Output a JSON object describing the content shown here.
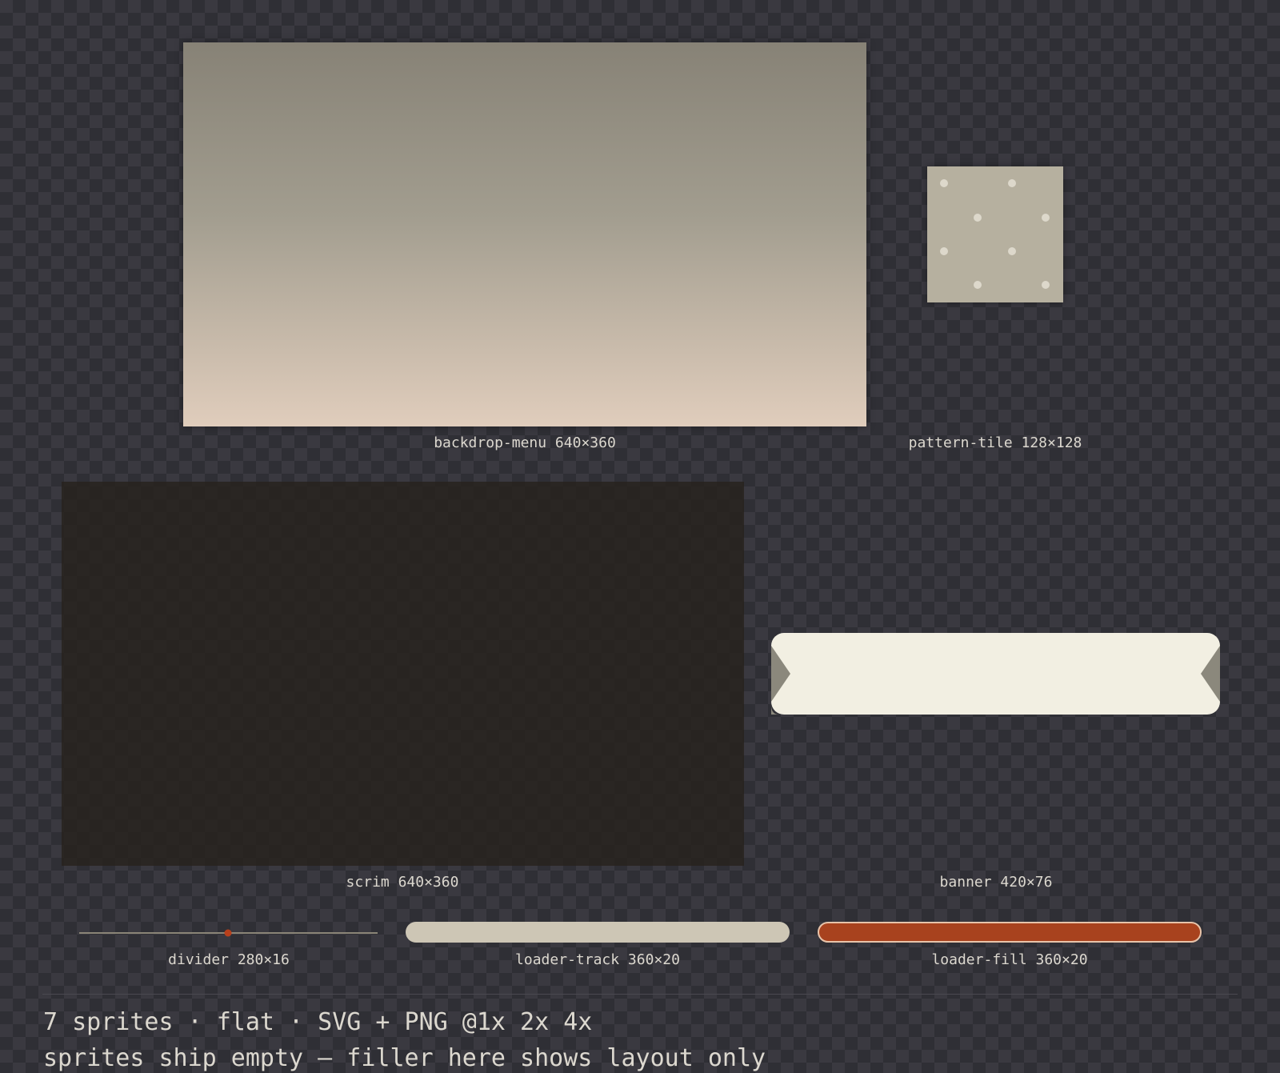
{
  "sprites": {
    "backdrop_menu": {
      "name": "backdrop-menu",
      "size": "640×360",
      "label": "backdrop-menu 640×360",
      "gradient_top": "#878276",
      "gradient_bottom": "#e0cdbc"
    },
    "pattern_tile": {
      "name": "pattern-tile",
      "size": "128×128",
      "label": "pattern-tile 128×128",
      "fill": "#b6b09f",
      "dot": "#ddd8cb"
    },
    "scrim": {
      "name": "scrim",
      "size": "640×360",
      "label": "scrim 640×360",
      "fill": "#28231e"
    },
    "banner": {
      "name": "banner",
      "size": "420×76",
      "label": "banner 420×76",
      "fill": "#f2efe2",
      "side": "#8b887c"
    },
    "divider": {
      "name": "divider",
      "size": "280×16",
      "label": "divider 280×16",
      "line": "#8a8577",
      "accent": "#b8401c"
    },
    "loader_track": {
      "name": "loader-track",
      "size": "360×20",
      "label": "loader-track 360×20",
      "fill": "#cdc6b5"
    },
    "loader_fill": {
      "name": "loader-fill",
      "size": "360×20",
      "label": "loader-fill 360×20",
      "fill": "#a8421e",
      "border": "#e8c4aa"
    }
  },
  "footer": {
    "summary": "7 sprites · flat · SVG + PNG @1x 2x 4x",
    "note": "sprites ship empty — filler here shows layout only"
  }
}
